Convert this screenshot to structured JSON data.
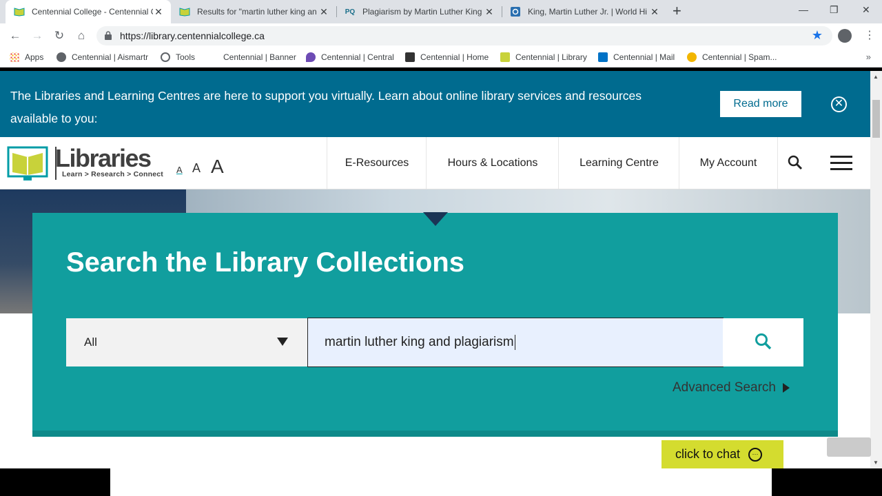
{
  "browser": {
    "tabs": [
      {
        "title": "Centennial College - Centennial C",
        "active": true
      },
      {
        "title": "Results for \"martin luther king an",
        "active": false
      },
      {
        "title": "Plagiarism by Martin Luther King",
        "active": false,
        "favicon_text": "PQ"
      },
      {
        "title": "King, Martin Luther Jr. | World Hi",
        "active": false
      }
    ],
    "url": "https://library.centennialcollege.ca",
    "bookmarks": [
      "Apps",
      "Centennial | Aismartr",
      "Tools",
      "Centennial | Banner",
      "Centennial | Central",
      "Centennial | Home",
      "Centennial | Library",
      "Centennial | Mail",
      "Centennial | Spam..."
    ],
    "more": "»"
  },
  "banner": {
    "text": "The Libraries and Learning Centres are here to support you virtually. Learn about online library services and resources available to you:",
    "read_more": "Read more"
  },
  "site": {
    "logo_word": "Libraries",
    "logo_tagline": "Learn > Research > Connect",
    "font_sizes": [
      "A",
      "A",
      "A"
    ],
    "nav": [
      "E-Resources",
      "Hours & Locations",
      "Learning Centre",
      "My Account"
    ]
  },
  "search": {
    "title": "Search the Library Collections",
    "scope": "All",
    "query": "martin luther king and plagiarism",
    "advanced": "Advanced Search"
  },
  "chat": {
    "label": "click to chat"
  },
  "colors": {
    "banner": "#006b8f",
    "panel": "#119e9e",
    "chat": "#d4dc2f"
  }
}
